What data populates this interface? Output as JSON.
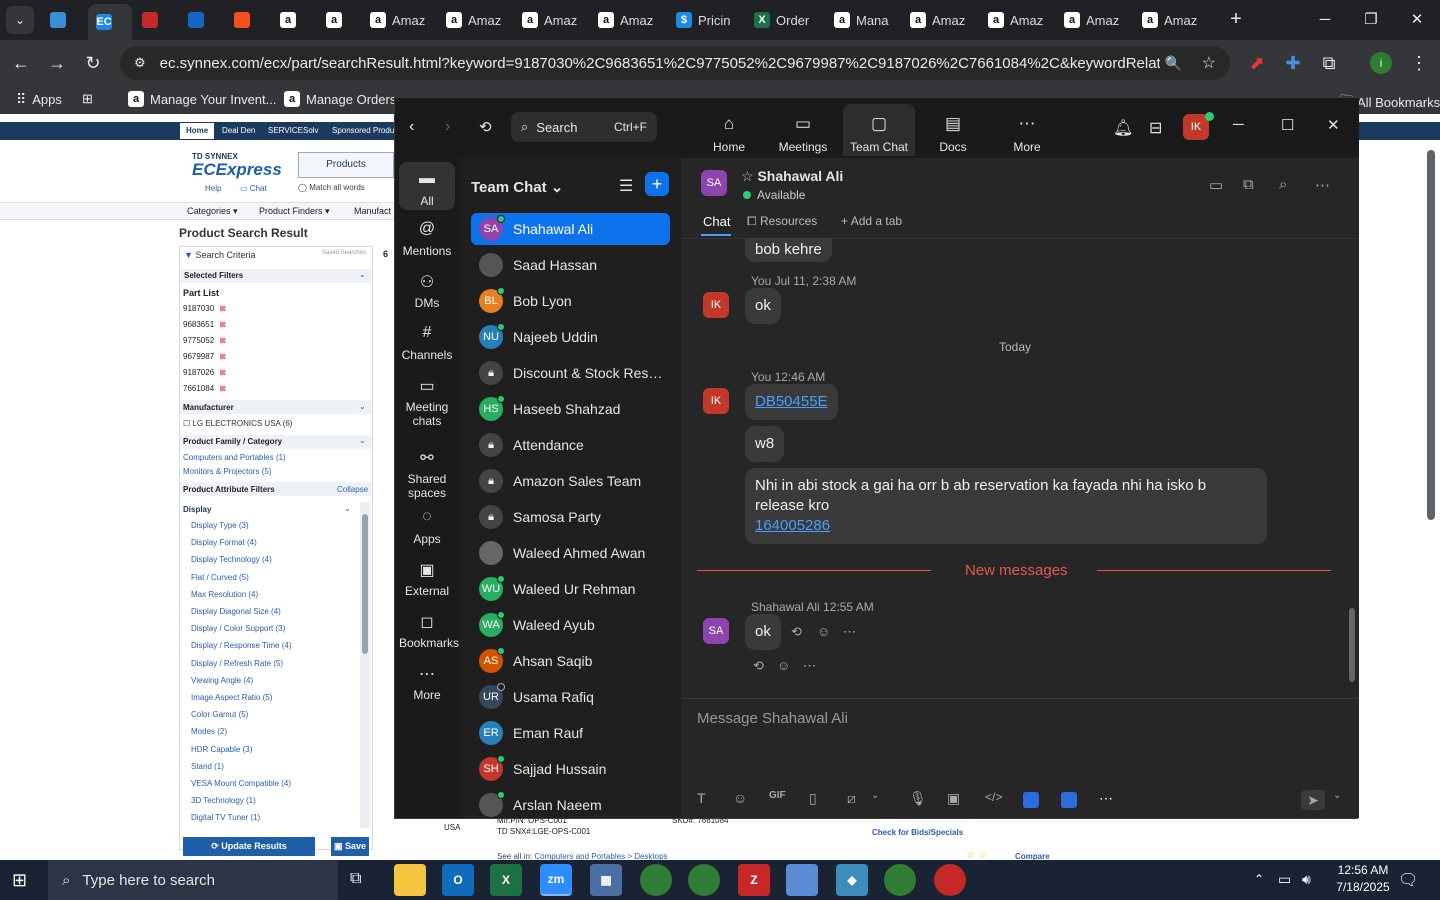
{
  "browser": {
    "tabs": [
      {
        "label": "",
        "icon": "edge-icon"
      },
      {
        "label": "",
        "icon": "ec-icon",
        "fav": "EC"
      },
      {
        "label": "",
        "icon": "dell-icon"
      },
      {
        "label": "",
        "icon": "g-icon"
      },
      {
        "label": "",
        "icon": "box-icon"
      },
      {
        "label": "",
        "icon": "amazon-icon",
        "fav": "a"
      },
      {
        "label": "",
        "icon": "amazon-icon",
        "fav": "a"
      },
      {
        "label": "Amaz",
        "icon": "amazon-icon",
        "fav": "a"
      },
      {
        "label": "Amaz",
        "icon": "amazon-icon",
        "fav": "a"
      },
      {
        "label": "Amaz",
        "icon": "amazon-icon",
        "fav": "a"
      },
      {
        "label": "Amaz",
        "icon": "amazon-icon",
        "fav": "a"
      },
      {
        "label": "Pricin",
        "icon": "dollar-icon",
        "fav": "$"
      },
      {
        "label": "Order",
        "icon": "excel-icon",
        "fav": "X"
      },
      {
        "label": "Mana",
        "icon": "amazon-icon",
        "fav": "a"
      },
      {
        "label": "Amaz",
        "icon": "amazon-icon",
        "fav": "a"
      },
      {
        "label": "Amaz",
        "icon": "amazon-icon",
        "fav": "a"
      },
      {
        "label": "Amaz",
        "icon": "amazon-icon",
        "fav": "a"
      },
      {
        "label": "Amaz",
        "icon": "amazon-icon",
        "fav": "a"
      }
    ],
    "url": "ec.synnex.com/ecx/part/searchResult.html?keyword=9187030%2C9683651%2C9775052%2C9679987%2C9187026%2C7661084%2C&keywordRelation=1&preff...",
    "bookmarks": {
      "apps": "Apps",
      "items": [
        "Manage Your Invent...",
        "Manage Orders"
      ],
      "all": "All Bookmarks"
    }
  },
  "synnex": {
    "nav_tabs": [
      "Home",
      "Deal Den",
      "SERVICESolv",
      "Sponsored Produ"
    ],
    "logo_top": "TD SYNNEX",
    "logo": "ECExpress",
    "help": "Help",
    "chat": "Chat",
    "products_btn": "Products",
    "match_all": "Match all words",
    "menu": [
      "Categories",
      "Product Finders",
      "Manufact"
    ],
    "heading": "Product Search Result",
    "search_criteria": "Search Criteria",
    "saved_searches": "Saved Searches",
    "selected_filters": "Selected Filters",
    "part_list": "Part List",
    "parts": [
      "9187030",
      "9683651",
      "9775052",
      "9679987",
      "9187026",
      "7661084"
    ],
    "manufacturer": "Manufacturer",
    "mfr_option": "LG ELECTRONICS USA",
    "mfr_count": "(6)",
    "family": "Product Family / Category",
    "families": [
      "Computers and Portables (1)",
      "Monitors & Projectors (5)"
    ],
    "attr_filters": "Product Attribute Filters",
    "collapse": "Collapse",
    "display": "Display",
    "attrs": [
      "Display Type (3)",
      "Display Format (4)",
      "Display Technology (4)",
      "Flat / Curved (5)",
      "Max Resolution (4)",
      "Display Diagonal Size (4)",
      "Display / Color Support (3)",
      "Display / Response Time (4)",
      "Display / Refresh Rate (5)",
      "Viewing Angle (4)",
      "Image Aspect Ratio (5)",
      "Color Gamut (5)",
      "Modes (2)",
      "HDR Capable (3)",
      "Stand (1)",
      "VESA Mount Compatible (4)",
      "3D Technology (1)",
      "Digital TV Tuner (1)"
    ],
    "update_btn": "Update Results",
    "save_btn": "Save",
    "result_count": "6",
    "bottom": {
      "usa": "USA",
      "mfr_pn": "Mfr.P/N: OPS-C001",
      "td_sku": "TD SNX#:LGE-OPS-C001",
      "sku": "SKU#: 7661084",
      "bids": "Check for Bids/Specials",
      "see_all": "See all in:",
      "see_all_link": "Computers and Portables > Desktops",
      "compare": "Compare"
    }
  },
  "zoom": {
    "search_label": "Search",
    "search_shortcut": "Ctrl+F",
    "top_tabs": [
      {
        "label": "Home",
        "icon": "home-icon"
      },
      {
        "label": "Meetings",
        "icon": "video-icon"
      },
      {
        "label": "Team Chat",
        "icon": "chat-icon"
      },
      {
        "label": "Docs",
        "icon": "docs-icon"
      },
      {
        "label": "More",
        "icon": "more-icon"
      }
    ],
    "user_initials": "IK",
    "rail": [
      {
        "label": "All",
        "icon": "chat-bubble-icon"
      },
      {
        "label": "Mentions",
        "icon": "at-icon"
      },
      {
        "label": "DMs",
        "icon": "people-icon"
      },
      {
        "label": "Channels",
        "icon": "hash-icon"
      },
      {
        "label": "Meeting chats",
        "icon": "calendar-icon"
      },
      {
        "label": "Shared spaces",
        "icon": "share-icon"
      },
      {
        "label": "Apps",
        "icon": "apps-icon"
      },
      {
        "label": "External",
        "icon": "external-icon"
      },
      {
        "label": "Bookmarks",
        "icon": "bookmark-icon"
      },
      {
        "label": "More",
        "icon": "more-icon"
      }
    ],
    "list_title": "Team Chat",
    "contacts": [
      {
        "name": "Shahawal Ali",
        "initials": "SA",
        "color": "#8e44ad",
        "status": "online"
      },
      {
        "name": "Saad Hassan",
        "initials": "",
        "color": "#555555",
        "status": "none"
      },
      {
        "name": "Bob Lyon",
        "initials": "BL",
        "color": "#e67e22",
        "status": "online"
      },
      {
        "name": "Najeeb Uddin",
        "initials": "NU",
        "color": "#2980b9",
        "status": "online"
      },
      {
        "name": "Discount & Stock Reser...",
        "initials": "",
        "color": "#444444",
        "status": "lock"
      },
      {
        "name": "Haseeb Shahzad",
        "initials": "HS",
        "color": "#27ae60",
        "status": "online"
      },
      {
        "name": "Attendance",
        "initials": "",
        "color": "#444444",
        "status": "lock"
      },
      {
        "name": "Amazon Sales Team",
        "initials": "",
        "color": "#444444",
        "status": "lock"
      },
      {
        "name": "Samosa Party",
        "initials": "",
        "color": "#444444",
        "status": "lock"
      },
      {
        "name": "Waleed Ahmed Awan",
        "initials": "",
        "color": "#666666",
        "status": "none"
      },
      {
        "name": "Waleed Ur Rehman",
        "initials": "WU",
        "color": "#27ae60",
        "status": "online"
      },
      {
        "name": "Waleed Ayub",
        "initials": "WA",
        "color": "#27ae60",
        "status": "online"
      },
      {
        "name": "Ahsan Saqib",
        "initials": "AS",
        "color": "#d35400",
        "status": "online"
      },
      {
        "name": "Usama Rafiq",
        "initials": "UR",
        "color": "#34495e",
        "status": "away"
      },
      {
        "name": "Eman Rauf",
        "initials": "ER",
        "color": "#2980b9",
        "status": "none"
      },
      {
        "name": "Sajjad Hussain",
        "initials": "SH",
        "color": "#c0392b",
        "status": "online"
      },
      {
        "name": "Arslan Naeem",
        "initials": "",
        "color": "#555555",
        "status": "online"
      }
    ],
    "chat": {
      "name": "Shahawal Ali",
      "initials": "SA",
      "status": "Available",
      "tabs": [
        "Chat",
        "Resources",
        "Add a tab"
      ],
      "prev_text": "bob kehre",
      "msg1_meta": "You Jul 11, 2:38 AM",
      "msg1": "ok",
      "today": "Today",
      "msg2_meta": "You 12:46 AM",
      "msg2_link": "DB50455E",
      "msg3": "w8",
      "msg4": "Nhi in abi stock a gai ha orr b ab reservation ka fayada nhi ha     isko b release kro",
      "msg4_link": "164005286",
      "new_messages": "New messages",
      "msg5_meta": "Shahawal Ali 12:55 AM",
      "msg5": "ok",
      "composer_placeholder": "Message Shahawal Ali"
    }
  },
  "taskbar": {
    "search": "Type here to search",
    "time": "12:56 AM",
    "date": "7/18/2025"
  }
}
